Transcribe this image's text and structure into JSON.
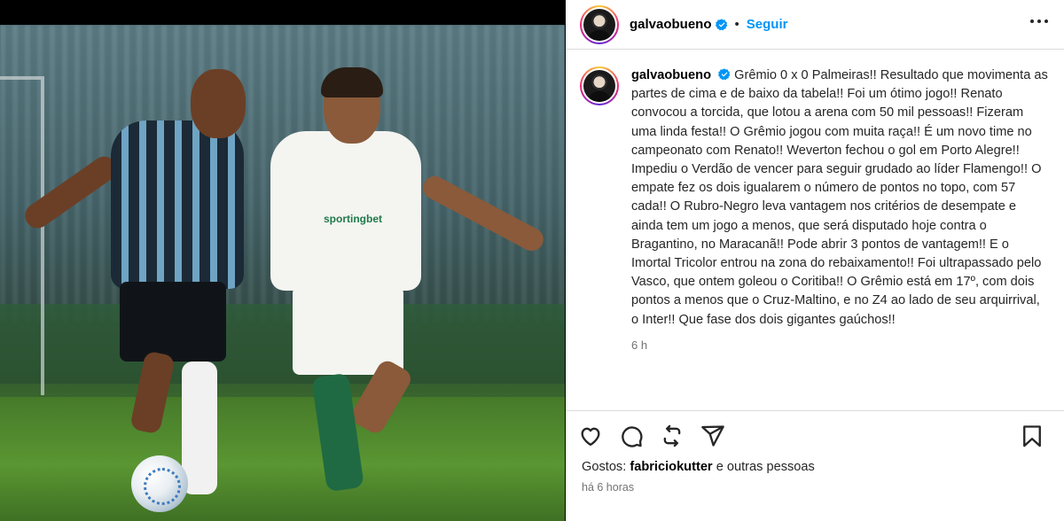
{
  "post": {
    "username": "galvaobueno",
    "follow_label": "Seguir",
    "separator": "•",
    "caption": "Grêmio 0 x 0 Palmeiras!! Resultado que movimenta as partes de cima e de baixo da tabela!! Foi um ótimo jogo!! Renato convocou a torcida, que lotou a arena com 50 mil pessoas!! Fizeram uma linda festa!! O Grêmio jogou com muita raça!! É um novo time no campeonato com Renato!! Weverton fechou o gol em Porto Alegre!! Impediu o Verdão de vencer para seguir grudado ao líder Flamengo!! O empate fez os dois igualarem o número de pontos no topo, com 57 cada!! O Rubro-Negro leva vantagem nos critérios de desempate e ainda tem um jogo a menos, que será disputado hoje contra o Bragantino, no Maracanã!! Pode abrir 3 pontos de vantagem!! E o Imortal Tricolor entrou na zona do rebaixamento!! Foi ultrapassado pelo Vasco, que ontem goleou o Coritiba!! O Grêmio está em 17º, com dois pontos a menos que o Cruz-Maltino, e no Z4 ao lado de seu arquirrival, o Inter!! Que fase dos dois gigantes gaúchos!!",
    "caption_age": "6 h",
    "likes_prefix": "Gostos:",
    "likes_user": "fabriciokutter",
    "likes_suffix": "e outras pessoas",
    "post_age": "há 6 horas"
  },
  "photo": {
    "jersey_text": "sportingbet"
  },
  "icons": {
    "verified": "verified-badge-icon",
    "more": "more-options-icon",
    "like": "heart-icon",
    "comment": "comment-icon",
    "repost": "repost-icon",
    "share": "share-icon",
    "save": "bookmark-icon"
  },
  "colors": {
    "accent": "#0095f6",
    "verified": "#0095f6",
    "text": "#262626",
    "muted": "#737373"
  }
}
